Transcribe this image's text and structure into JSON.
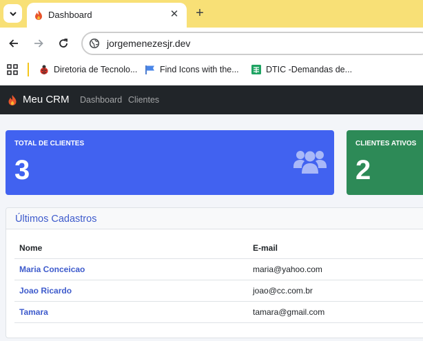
{
  "browser": {
    "tab": {
      "title": "Dashboard",
      "close": "✕"
    },
    "new_tab": "+",
    "url": "jorgemenezesjr.dev",
    "bookmarks": [
      {
        "label": "Diretoria de Tecnolo..."
      },
      {
        "label": "Find Icons with the..."
      },
      {
        "label": "DTIC -Demandas de..."
      }
    ]
  },
  "navbar": {
    "brand": "Meu CRM",
    "links": [
      "Dashboard",
      "Clientes"
    ]
  },
  "stats": [
    {
      "label": "TOTAL DE CLIENTES",
      "value": "3",
      "color": "#4162f0"
    },
    {
      "label": "CLIENTES ATIVOS",
      "value": "2",
      "color": "#2d8a57"
    }
  ],
  "recent": {
    "title": "Últimos Cadastros",
    "columns": [
      "Nome",
      "E-mail"
    ],
    "rows": [
      {
        "name": "Maria Conceicao",
        "email": "maria@yahoo.com"
      },
      {
        "name": "Joao Ricardo",
        "email": "joao@cc.com.br"
      },
      {
        "name": "Tamara",
        "email": "tamara@gmail.com"
      }
    ]
  },
  "icons": [
    "chevron-down-icon",
    "fire-icon",
    "back-arrow-icon",
    "forward-arrow-icon",
    "reload-icon",
    "site-info-icon",
    "apps-grid-icon",
    "ladybug-icon",
    "flag-icon",
    "sheets-icon",
    "users-icon"
  ]
}
